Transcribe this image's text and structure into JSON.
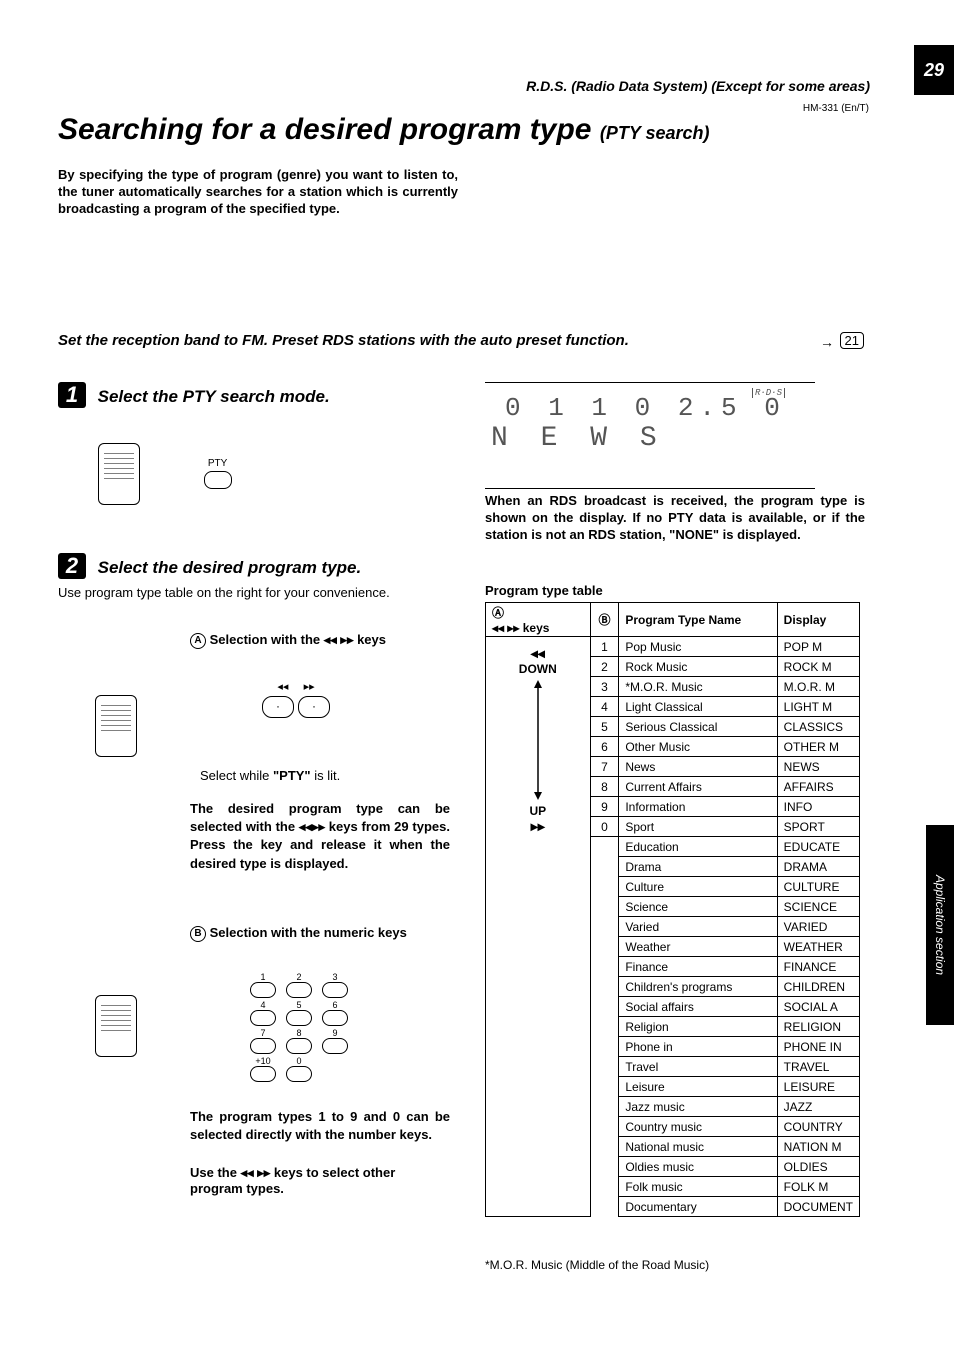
{
  "page_number": "29",
  "header_rds": "R.D.S. (Radio Data System) (Except for some areas)",
  "model": "HM-331 (En/T)",
  "side_tab": "Application section",
  "title_main": "Searching for a desired program type",
  "title_sub": "(PTY search)",
  "intro": "By specifying the type of program (genre) you want to listen to, the tuner automatically searches for a station which is currently broadcasting a program of the specified type.",
  "set_band": "Set the reception band to FM.  Preset RDS stations with the auto preset function.",
  "page_ref": "21",
  "step1": {
    "num": "1",
    "title": "Select the PTY search mode.",
    "pty_label": "PTY"
  },
  "step2": {
    "num": "2",
    "title": "Select the desired program type.",
    "intro": "Use program type table on the right for your convenience.",
    "sel_a_label": "Selection with the ◂◂ ▸▸ keys",
    "sel_a_note1": "Select while \"PTY\" is lit.",
    "sel_a_note1_prefix": "Select while ",
    "sel_a_note1_bold": "\"PTY\"",
    "sel_a_note1_suffix": " is lit.",
    "sel_a_note2": "The desired program type can be selected with the ◂◂▸▸ keys from 29 types. Press the key and release it when the desired type is displayed.",
    "sel_b_label": "Selection with the numeric keys",
    "keypad": [
      "1",
      "2",
      "3",
      "4",
      "5",
      "6",
      "7",
      "8",
      "9",
      "+10",
      "0"
    ],
    "sel_b_note": "The program types 1 to 9 and 0 can be selected directly with the number keys.",
    "sel_b_note2": "Use the ◂◂ ▸▸ keys to select other program types."
  },
  "display": {
    "line1": "0 1   1 0 2.5 0",
    "line2": "N E W S",
    "rds": "R·D·S",
    "note": "When an RDS broadcast is received, the program type is shown on the display. If no PTY data is available, or if the station is not an RDS station, \"NONE\" is displayed."
  },
  "table": {
    "title": "Program type table",
    "col_a_header_1": "Ⓐ",
    "col_a_header_2": "◂◂ ▸▸ keys",
    "col_b_header": "Ⓑ",
    "col_name": "Program Type Name",
    "col_display": "Display",
    "keys_down_sym": "◂◂",
    "keys_down_label": "DOWN",
    "keys_up_label": "UP",
    "keys_up_sym": "▸▸",
    "rows": [
      {
        "n": "1",
        "name": "Pop Music",
        "disp": "POP M"
      },
      {
        "n": "2",
        "name": "Rock Music",
        "disp": "ROCK M"
      },
      {
        "n": "3",
        "name": "*M.O.R. Music",
        "disp": "M.O.R. M"
      },
      {
        "n": "4",
        "name": "Light Classical",
        "disp": "LIGHT M"
      },
      {
        "n": "5",
        "name": "Serious Classical",
        "disp": "CLASSICS"
      },
      {
        "n": "6",
        "name": "Other Music",
        "disp": "OTHER M"
      },
      {
        "n": "7",
        "name": "News",
        "disp": "NEWS"
      },
      {
        "n": "8",
        "name": "Current Affairs",
        "disp": "AFFAIRS"
      },
      {
        "n": "9",
        "name": "Information",
        "disp": "INFO"
      },
      {
        "n": "0",
        "name": "Sport",
        "disp": "SPORT"
      },
      {
        "n": "",
        "name": "Education",
        "disp": "EDUCATE"
      },
      {
        "n": "",
        "name": "Drama",
        "disp": "DRAMA"
      },
      {
        "n": "",
        "name": "Culture",
        "disp": "CULTURE"
      },
      {
        "n": "",
        "name": "Science",
        "disp": "SCIENCE"
      },
      {
        "n": "",
        "name": "Varied",
        "disp": "VARIED"
      },
      {
        "n": "",
        "name": "Weather",
        "disp": "WEATHER"
      },
      {
        "n": "",
        "name": "Finance",
        "disp": "FINANCE"
      },
      {
        "n": "",
        "name": "Children's programs",
        "disp": "CHILDREN"
      },
      {
        "n": "",
        "name": "Social affairs",
        "disp": "SOCIAL A"
      },
      {
        "n": "",
        "name": "Religion",
        "disp": "RELIGION"
      },
      {
        "n": "",
        "name": "Phone in",
        "disp": "PHONE IN"
      },
      {
        "n": "",
        "name": "Travel",
        "disp": "TRAVEL"
      },
      {
        "n": "",
        "name": "Leisure",
        "disp": "LEISURE"
      },
      {
        "n": "",
        "name": "Jazz music",
        "disp": "JAZZ"
      },
      {
        "n": "",
        "name": "Country music",
        "disp": "COUNTRY"
      },
      {
        "n": "",
        "name": "National music",
        "disp": "NATION M"
      },
      {
        "n": "",
        "name": "Oldies music",
        "disp": "OLDIES"
      },
      {
        "n": "",
        "name": "Folk music",
        "disp": "FOLK M"
      },
      {
        "n": "",
        "name": "Documentary",
        "disp": "DOCUMENT"
      }
    ],
    "footnote": "*M.O.R. Music (Middle of the Road Music)"
  }
}
